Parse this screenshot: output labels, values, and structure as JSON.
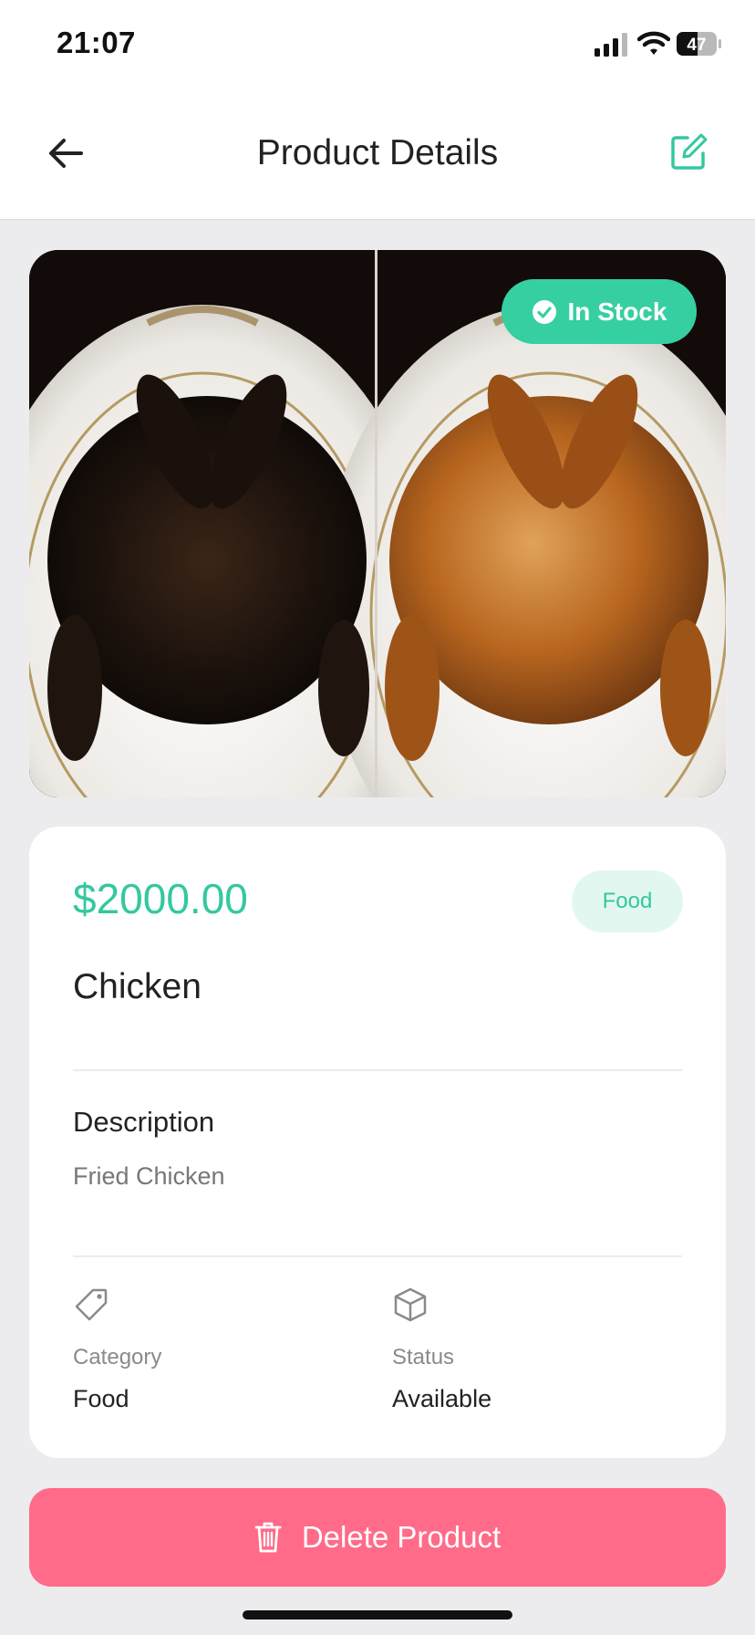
{
  "status_bar": {
    "time": "21:07",
    "battery_level": "47"
  },
  "header": {
    "title": "Product Details",
    "back_icon": "arrow-left-icon",
    "edit_icon": "edit-square-icon"
  },
  "product": {
    "image_icon": "roast-chicken-photo",
    "stock_badge": "In Stock",
    "price": "$2000.00",
    "category_chip": "Food",
    "name": "Chicken",
    "description_heading": "Description",
    "description": "Fried Chicken",
    "category_label": "Category",
    "category_value": "Food",
    "category_icon": "tag-icon",
    "status_label": "Status",
    "status_value": "Available",
    "status_icon": "box-icon"
  },
  "actions": {
    "delete_label": "Delete Product",
    "delete_icon": "trash-icon"
  },
  "colors": {
    "accent": "#36cfa2",
    "accent_light": "#e3f7f1",
    "danger": "#ff6b88",
    "background": "#ececee"
  }
}
